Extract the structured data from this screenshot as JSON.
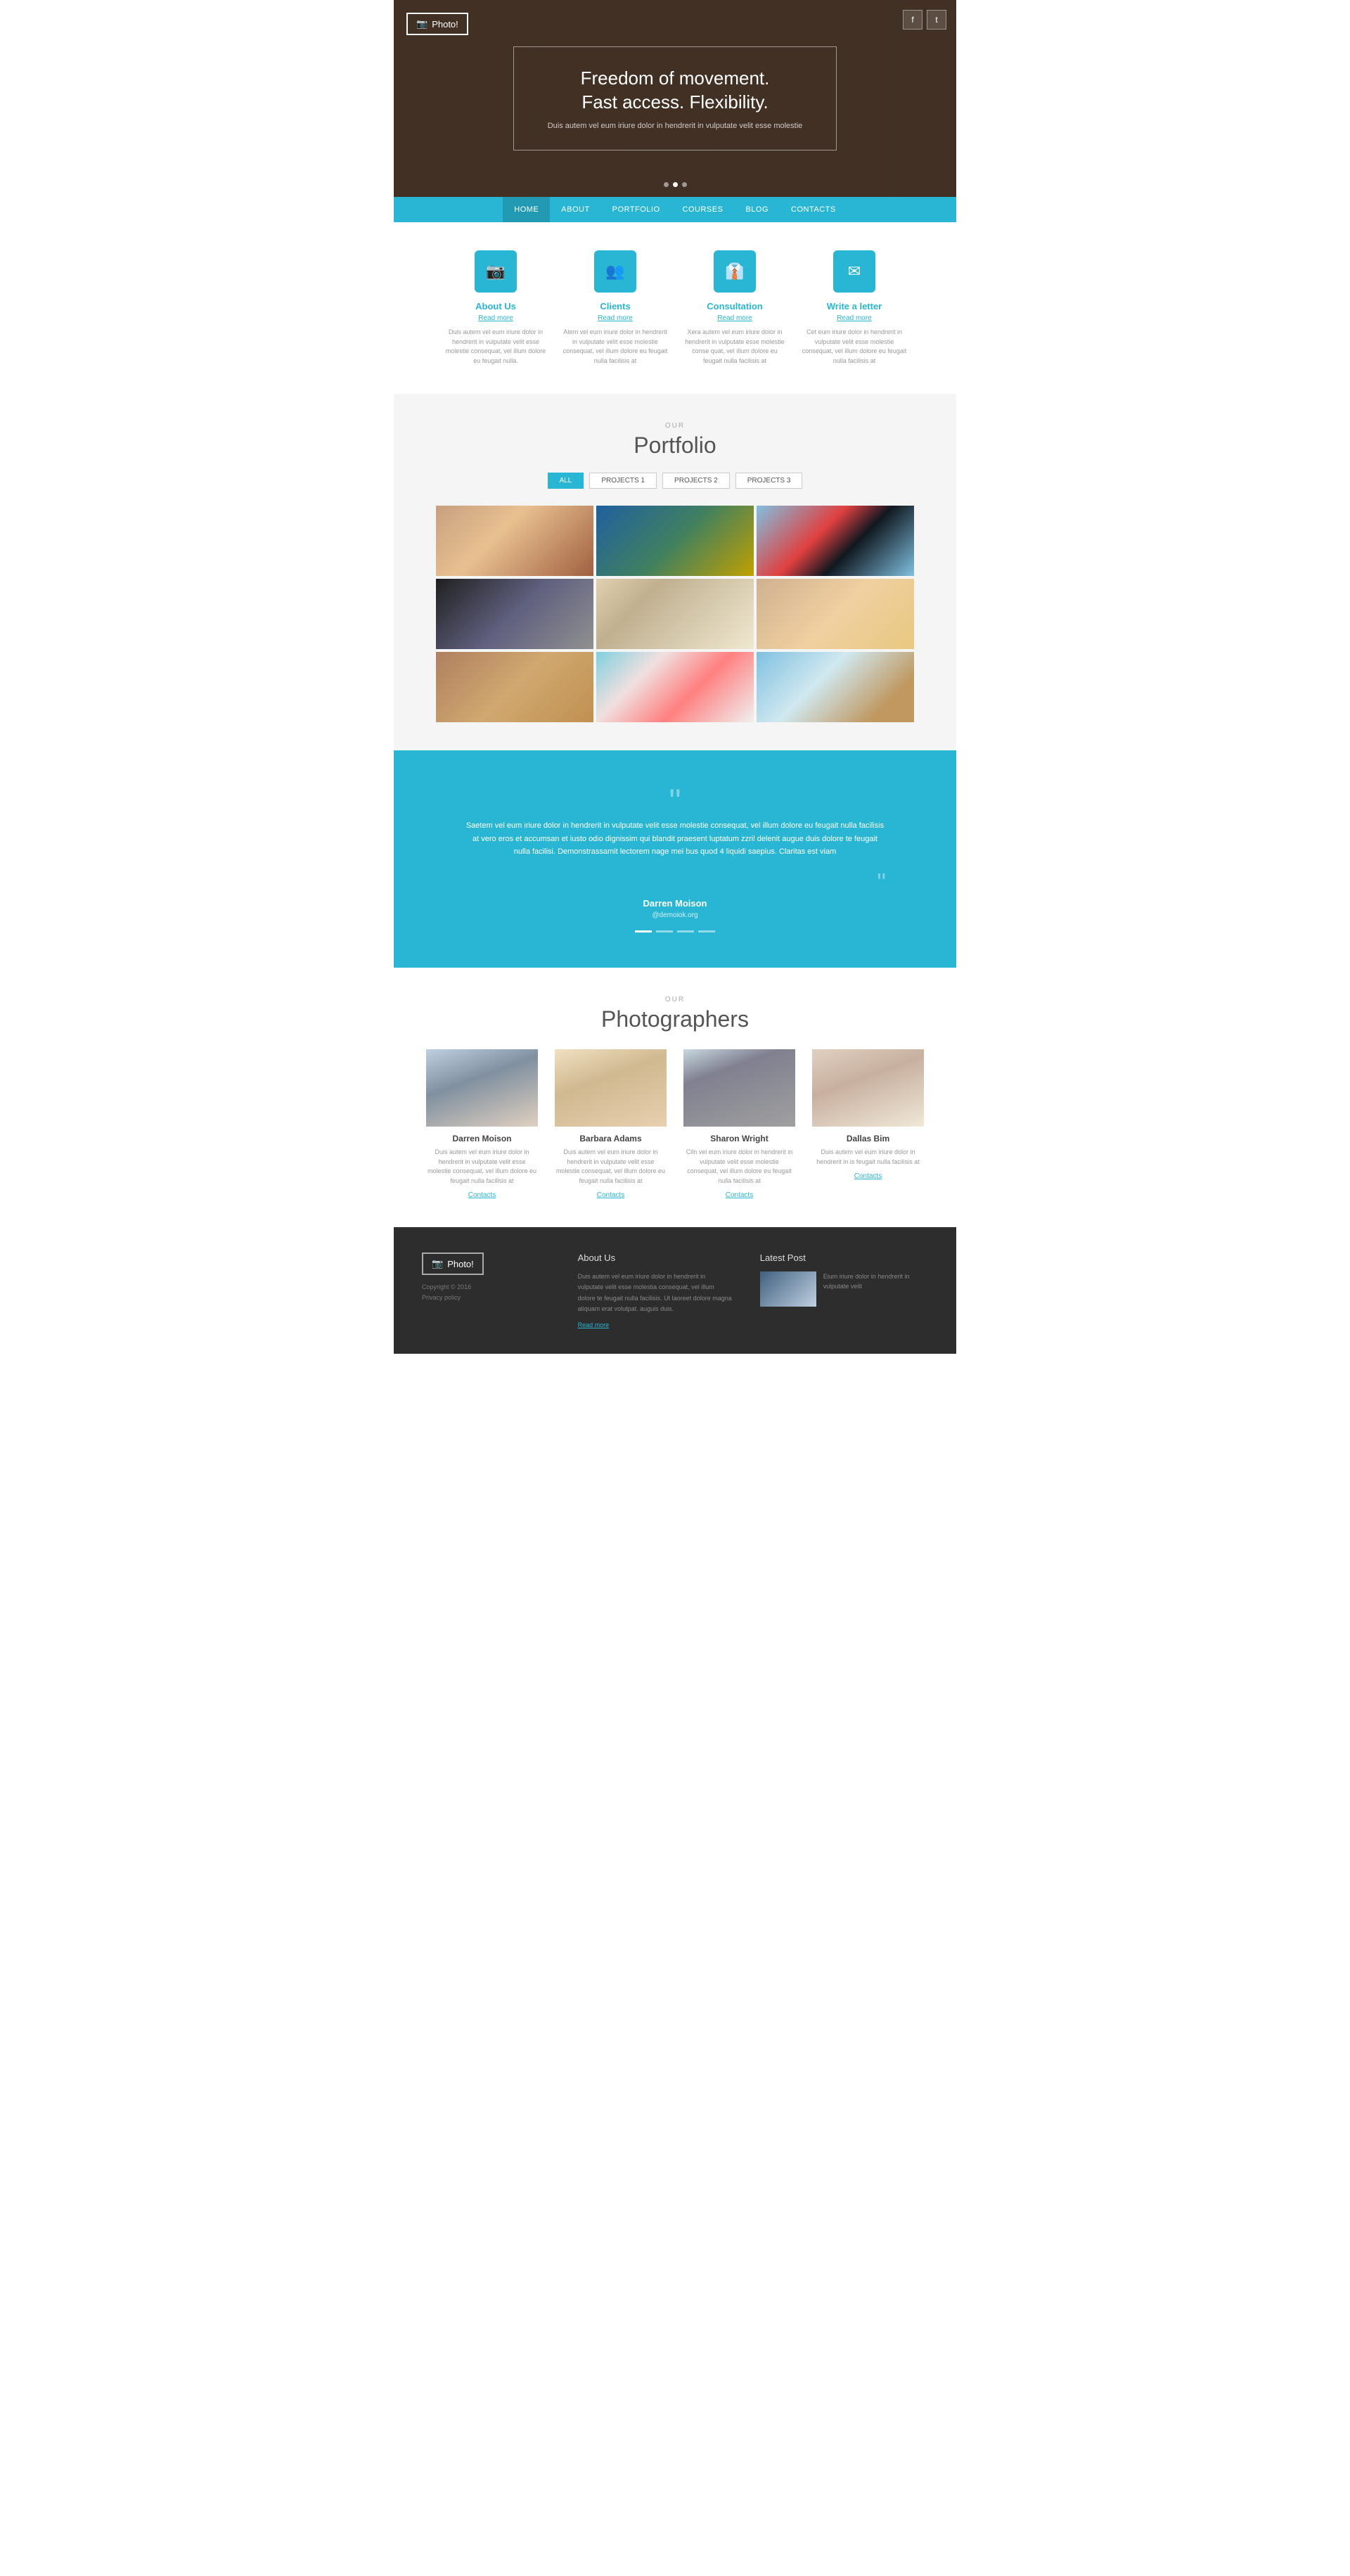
{
  "brand": {
    "logo_label": "Photo!",
    "camera_icon": "📷"
  },
  "social": {
    "facebook": "f",
    "twitter": "t"
  },
  "hero": {
    "title_line1": "Freedom of movement.",
    "title_line2": "Fast access. Flexibility.",
    "subtitle": "Duis autem vel eum iriure dolor in hendrerit in vulputate velit esse molestie",
    "dots": [
      false,
      true,
      false
    ]
  },
  "nav": {
    "items": [
      {
        "label": "HOME",
        "active": true
      },
      {
        "label": "ABOUT",
        "active": false
      },
      {
        "label": "PORTFOLIO",
        "active": false
      },
      {
        "label": "COURSES",
        "active": false
      },
      {
        "label": "BLOG",
        "active": false
      },
      {
        "label": "CONTACTS",
        "active": false
      }
    ]
  },
  "features": [
    {
      "icon": "📷",
      "title": "About Us",
      "read_more": "Read more",
      "text": "Duis autem vel eum iriure dolor in hendrerit in vulputate velit esse molestie consequat, vel illum dolore eu feugait nulla."
    },
    {
      "icon": "👥",
      "title": "Clients",
      "read_more": "Read more",
      "text": "Atem vel eum iriure dolor in hendrerit in vulputate velit esse molestie consequat, vel illum dolore eu feugait nulla facilisis at"
    },
    {
      "icon": "👔",
      "title": "Consultation",
      "read_more": "Read more",
      "text": "Xera autem vel eum iriure dolor in hendrerit in vulputate esse molestie conse quat, vel illum dolore eu feugait nulla facilisis at"
    },
    {
      "icon": "✉",
      "title": "Write a letter",
      "read_more": "Read more",
      "text": "Cet eum iriure dolor in hendrerit in vulputate velit esse molestie consequat, vel illum dolore eu feugait nulla facilisis at"
    }
  ],
  "portfolio": {
    "section_label": "OUR",
    "section_title": "Portfolio",
    "filters": [
      "ALL",
      "PROJECTS 1",
      "PROJECTS 2",
      "PROJECTS 3"
    ],
    "active_filter": "ALL",
    "images": [
      "pi-1",
      "pi-2",
      "pi-3",
      "pi-4",
      "pi-5",
      "pi-6",
      "pi-7",
      "pi-8",
      "pi-9"
    ]
  },
  "testimonial": {
    "text": "Saetem vel eum iriure dolor in hendrerit in vulputate velit esse molestie consequat, vel illum dolore eu feugait nulla facilisis at vero eros et accumsan et iusto odio dignissim qui blandit praesent luptatum zzril delenit augue duis dolore te feugait nulla facilisi. Demonstrassamit lectorem nage mei bus quod 4 liquidi saepius. Claritas est viam",
    "name": "Darren Moison",
    "handle": "@demoiok.org",
    "dots": [
      true,
      false,
      false,
      false
    ]
  },
  "photographers": {
    "section_label": "OUR",
    "section_title": "Photographers",
    "people": [
      {
        "name": "Darren Moison",
        "img_class": "ph-1",
        "desc": "Duis autem vel eum iriure dolor in hendrerit in vulputate velit esse molestie consequat, vel illum dolore eu feugait nulla facilisis at",
        "contact_label": "Contacts"
      },
      {
        "name": "Barbara Adams",
        "img_class": "ph-2",
        "desc": "Duis autem vel eum iriure dolor in hendrerit in vulputate velit esse molestie consequat, vel illum dolore eu feugait nulla facilisis at",
        "contact_label": "Contacts"
      },
      {
        "name": "Sharon Wright",
        "img_class": "ph-3",
        "desc": "Ciln vel eum iriure dolor in hendrerit in vulputate velit esse molestie consequat, vel illum dolore eu feugait nulla facilisis at",
        "contact_label": "Contacts"
      },
      {
        "name": "Dallas Bim",
        "img_class": "ph-4",
        "desc": "Duis autem vel eum iriure dolor in hendrerit in is feugait nulla facilisis at",
        "contact_label": "Contacts"
      }
    ]
  },
  "footer": {
    "logo_label": "Photo!",
    "copyright": "Copyright © 2016",
    "privacy": "Privacy policy",
    "about_title": "About Us",
    "about_text": "Duis autem vel eum iriure dolor in hendrerit in vulputate velit esse molestia consequat, vel illum dolore te feugait nulla facilisis. Ut laoreet dolore magna aliquam erat volutpat. auguis duis.",
    "about_read_more": "Read more",
    "latest_title": "Latest Post",
    "latest_text": "Eium iriure dolor in hendrerit in vulputate velit"
  }
}
